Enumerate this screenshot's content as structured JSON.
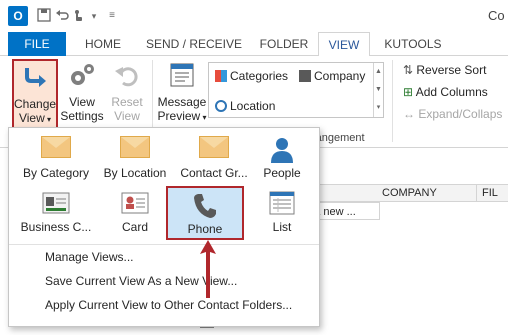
{
  "title_bar": {
    "app_logo": "O",
    "window_title_partial": "Co",
    "qat_icons": [
      "save-icon",
      "undo-icon",
      "touch-mode-icon",
      "customize-icon"
    ]
  },
  "ribbon_tabs": [
    "FILE",
    "HOME",
    "SEND / RECEIVE",
    "FOLDER",
    "VIEW",
    "KUTOOLS"
  ],
  "active_tab": "VIEW",
  "ribbon": {
    "change_view": {
      "line1": "Change",
      "line2": "View"
    },
    "view_settings": {
      "line1": "View",
      "line2": "Settings"
    },
    "reset_view": {
      "line1": "Reset",
      "line2": "View"
    },
    "message_preview": {
      "line1": "Message",
      "line2": "Preview"
    },
    "arrangement_gallery": [
      "Categories",
      "Company",
      "Location"
    ],
    "side_commands": [
      "Reverse Sort",
      "Add Columns",
      "Expand/Collaps"
    ],
    "arrangement_group_label": "rangement"
  },
  "content": {
    "column_headers": [
      "COMPANY",
      "FIL"
    ],
    "new_row_text": "d a new ..."
  },
  "change_view_menu": {
    "views": [
      {
        "label": "By Category",
        "icon": "envelope-icon"
      },
      {
        "label": "By Location",
        "icon": "envelope-icon"
      },
      {
        "label": "Contact Gr...",
        "icon": "envelope-icon"
      },
      {
        "label": "People",
        "icon": "person-icon"
      },
      {
        "label": "Business C...",
        "icon": "business-card-icon"
      },
      {
        "label": "Card",
        "icon": "contact-card-icon"
      },
      {
        "label": "Phone",
        "icon": "phone-icon"
      },
      {
        "label": "List",
        "icon": "list-icon"
      }
    ],
    "selected_view": "Phone",
    "commands": [
      "Manage Views...",
      "Save Current View As a New View...",
      "Apply Current View to Other Contact Folders..."
    ]
  },
  "colors": {
    "file_tab": "#0072c6",
    "highlight_border": "#b0272c",
    "selected_fill": "#cce4f7",
    "arrow": "#b0272c"
  }
}
